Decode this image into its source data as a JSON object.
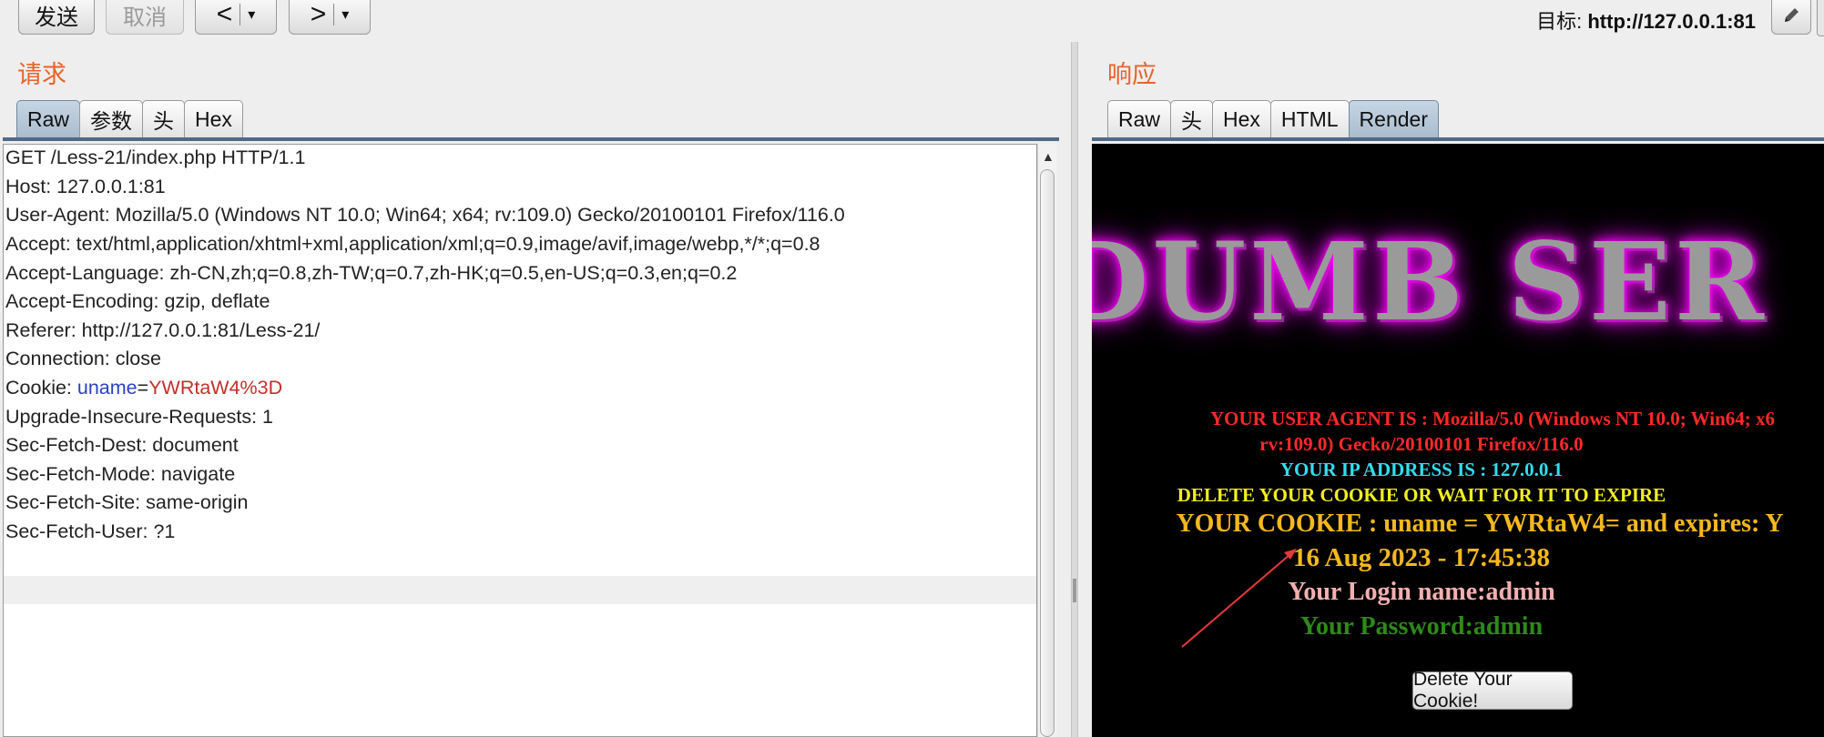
{
  "toolbar": {
    "send": "发送",
    "cancel": "取消",
    "back": "<",
    "forward": ">",
    "dropdown": "▾",
    "target_prefix": "目标: ",
    "target_url": "http://127.0.0.1:81"
  },
  "request": {
    "title": "请求",
    "tabs": [
      "Raw",
      "参数",
      "头",
      "Hex"
    ],
    "active_tab": "Raw",
    "lines": [
      "GET /Less-21/index.php HTTP/1.1",
      "Host: 127.0.0.1:81",
      "User-Agent: Mozilla/5.0 (Windows NT 10.0; Win64; x64; rv:109.0) Gecko/20100101 Firefox/116.0",
      "Accept: text/html,application/xhtml+xml,application/xml;q=0.9,image/avif,image/webp,*/*;q=0.8",
      "Accept-Language: zh-CN,zh;q=0.8,zh-TW;q=0.7,zh-HK;q=0.5,en-US;q=0.3,en;q=0.2",
      "Accept-Encoding: gzip, deflate",
      "Referer: http://127.0.0.1:81/Less-21/",
      "Connection: close"
    ],
    "cookie_prefix": "Cookie: ",
    "cookie_name": "uname",
    "cookie_eq": "=",
    "cookie_value": "YWRtaW4%3D",
    "lines_after": [
      "Upgrade-Insecure-Requests: 1",
      "Sec-Fetch-Dest: document",
      "Sec-Fetch-Mode: navigate",
      "Sec-Fetch-Site: same-origin",
      "Sec-Fetch-User: ?1"
    ]
  },
  "response": {
    "title": "响应",
    "tabs": [
      "Raw",
      "头",
      "Hex",
      "HTML",
      "Render"
    ],
    "active_tab": "Render",
    "render": {
      "banner": "DUMB SER",
      "user_agent_1": "YOUR USER AGENT IS : Mozilla/5.0 (Windows NT 10.0; Win64; x6",
      "user_agent_2": "rv:109.0) Gecko/20100101 Firefox/116.0",
      "ip": "YOUR IP ADDRESS IS : 127.0.0.1",
      "delete_note": "DELETE YOUR COOKIE OR WAIT FOR IT TO EXPIRE",
      "cookie": "YOUR COOKIE : uname = YWRtaW4= and expires: Y",
      "expires": "16 Aug 2023 - 17:45:38",
      "login": "Your Login name:admin",
      "password": "Your Password:admin",
      "delete_button": "Delete Your Cookie!"
    }
  },
  "colors": {
    "panel_title": "#e8632a",
    "ua_text": "#ff2a2a",
    "ip_text": "#33ddee",
    "delete_text": "#f2ee22",
    "cookie_text": "#f5b81e",
    "login_text": "#f4b0b0",
    "password_text": "#2e8a18",
    "annotation_arrow": "#e53a3a"
  }
}
